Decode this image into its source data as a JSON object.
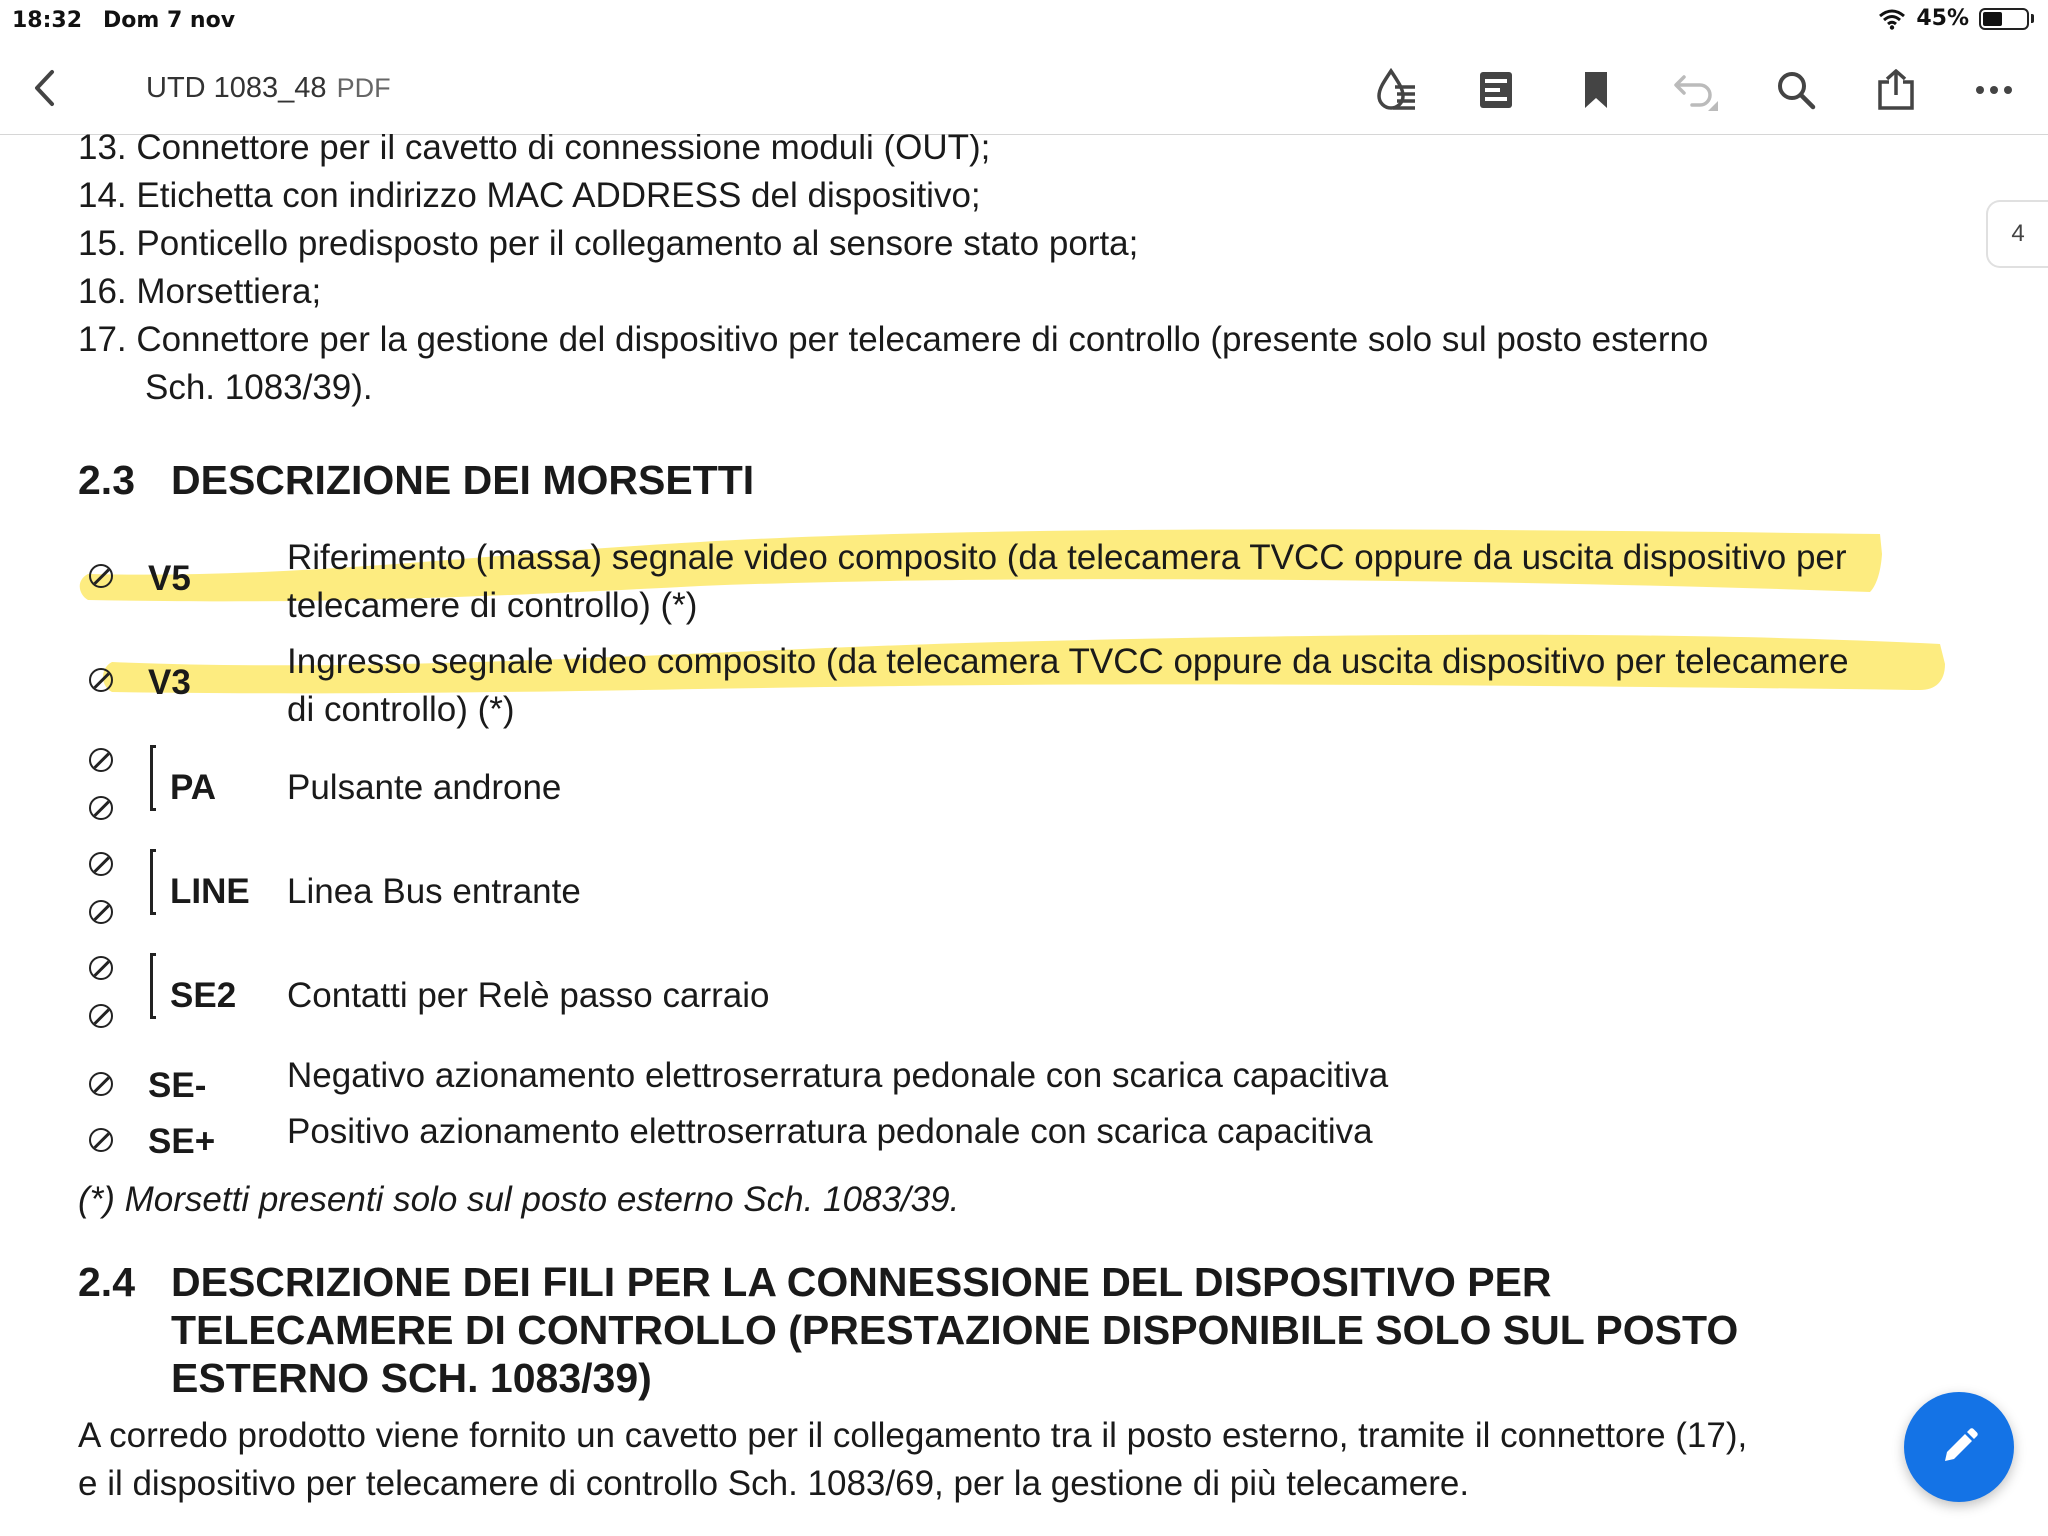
{
  "status_bar": {
    "time": "18:32",
    "date": "Dom 7 nov",
    "battery_percent": "45%",
    "battery_level": 0.45
  },
  "toolbar": {
    "doc_title": "UTD 1083_48",
    "doc_type": "PDF",
    "icons": [
      "back-chevron-icon",
      "liquid-mode-icon",
      "outline-icon",
      "bookmark-icon",
      "undo-icon",
      "search-icon",
      "share-icon",
      "more-icon"
    ]
  },
  "page_indicator": "4",
  "list_items": [
    {
      "num": "13.",
      "text": "Connettore per il cavetto di connessione moduli (OUT);"
    },
    {
      "num": "14.",
      "text": "Etichetta con indirizzo MAC ADDRESS del dispositivo;"
    },
    {
      "num": "15.",
      "text": "Ponticello predisposto per il collegamento al sensore stato porta;"
    },
    {
      "num": "16.",
      "text": "Morsettiera;"
    },
    {
      "num": "17.",
      "text": "Connettore per la gestione del dispositivo per telecamere di controllo (presente solo sul posto esterno"
    }
  ],
  "list_item_17_cont": "Sch. 1083/39).",
  "section_2_3": {
    "num": "2.3",
    "title": "DESCRIZIONE DEI MORSETTI"
  },
  "terminals": [
    {
      "code": "V5",
      "desc_line1": "Riferimento (massa) segnale video composito (da telecamera TVCC oppure da uscita dispositivo per",
      "desc_line2": "telecamere di controllo) (*)",
      "highlighted": true
    },
    {
      "code": "V3",
      "desc_line1": "Ingresso segnale video composito (da telecamera TVCC oppure da uscita dispositivo per telecamere",
      "desc_line2": "di controllo) (*)",
      "highlighted": true
    },
    {
      "code": "PA",
      "desc_line1": "Pulsante androne"
    },
    {
      "code": "LINE",
      "desc_line1": "Linea Bus entrante"
    },
    {
      "code": "SE2",
      "desc_line1": "Contatti per Relè passo carraio"
    },
    {
      "code": "SE-",
      "desc_line1": "Negativo azionamento elettroserratura pedonale con scarica capacitiva"
    },
    {
      "code": "SE+",
      "desc_line1": "Positivo azionamento elettroserratura pedonale con scarica capacitiva"
    }
  ],
  "footnote": "(*) Morsetti presenti solo sul posto esterno Sch. 1083/39.",
  "section_2_4": {
    "num": "2.4",
    "title_line1": "DESCRIZIONE DEI FILI PER LA CONNESSIONE DEL DISPOSITIVO PER",
    "title_line2": "TELECAMERE DI CONTROLLO (PRESTAZIONE DISPONIBILE SOLO SUL POSTO",
    "title_line3": "ESTERNO SCH. 1083/39)"
  },
  "paragraph": {
    "line1": "A corredo prodotto viene fornito un cavetto per il collegamento tra il posto esterno, tramite il connettore (17),",
    "line2": "e il dispositivo per telecamere di controllo Sch. 1083/69, per la gestione di più telecamere."
  },
  "colors": {
    "highlight": "#fde96a",
    "accent": "#1473e6",
    "text": "#1a1a1a"
  }
}
